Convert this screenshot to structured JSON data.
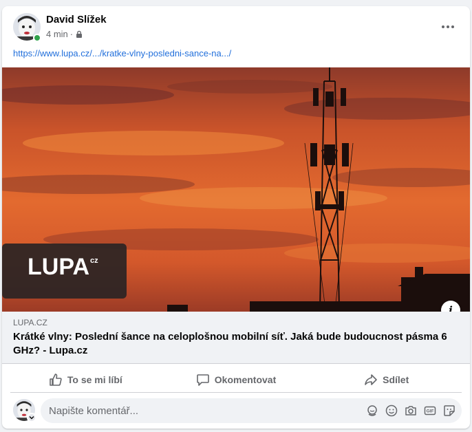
{
  "post": {
    "author": "David Slížek",
    "time": "4 min",
    "separator": "·",
    "privacy_icon": "lock-icon",
    "more_icon": "more-options-icon",
    "link_url": "https://www.lupa.cz/.../kratke-vlny-posledni-sance-na.../"
  },
  "link_preview": {
    "logo_text": "LUPA",
    "logo_suffix": "cz",
    "domain": "LUPA.CZ",
    "title": "Krátké vlny: Poslední šance na celoplošnou mobilní síť. Jaká bude budoucnost pásma 6 GHz? - Lupa.cz",
    "info_icon": "i"
  },
  "actions": {
    "like": "To se mi líbí",
    "comment": "Okomentovat",
    "share": "Sdílet"
  },
  "comment_box": {
    "placeholder": "Napište komentář...",
    "icons": [
      "avatar-sticker-icon",
      "emoji-icon",
      "camera-icon",
      "gif-icon",
      "sticker-icon"
    ]
  },
  "colors": {
    "link": "#216fdb",
    "online": "#31a24c",
    "secondary_text": "#65676b",
    "sky_top": "#b84a24",
    "sky_mid": "#e56a2c"
  }
}
